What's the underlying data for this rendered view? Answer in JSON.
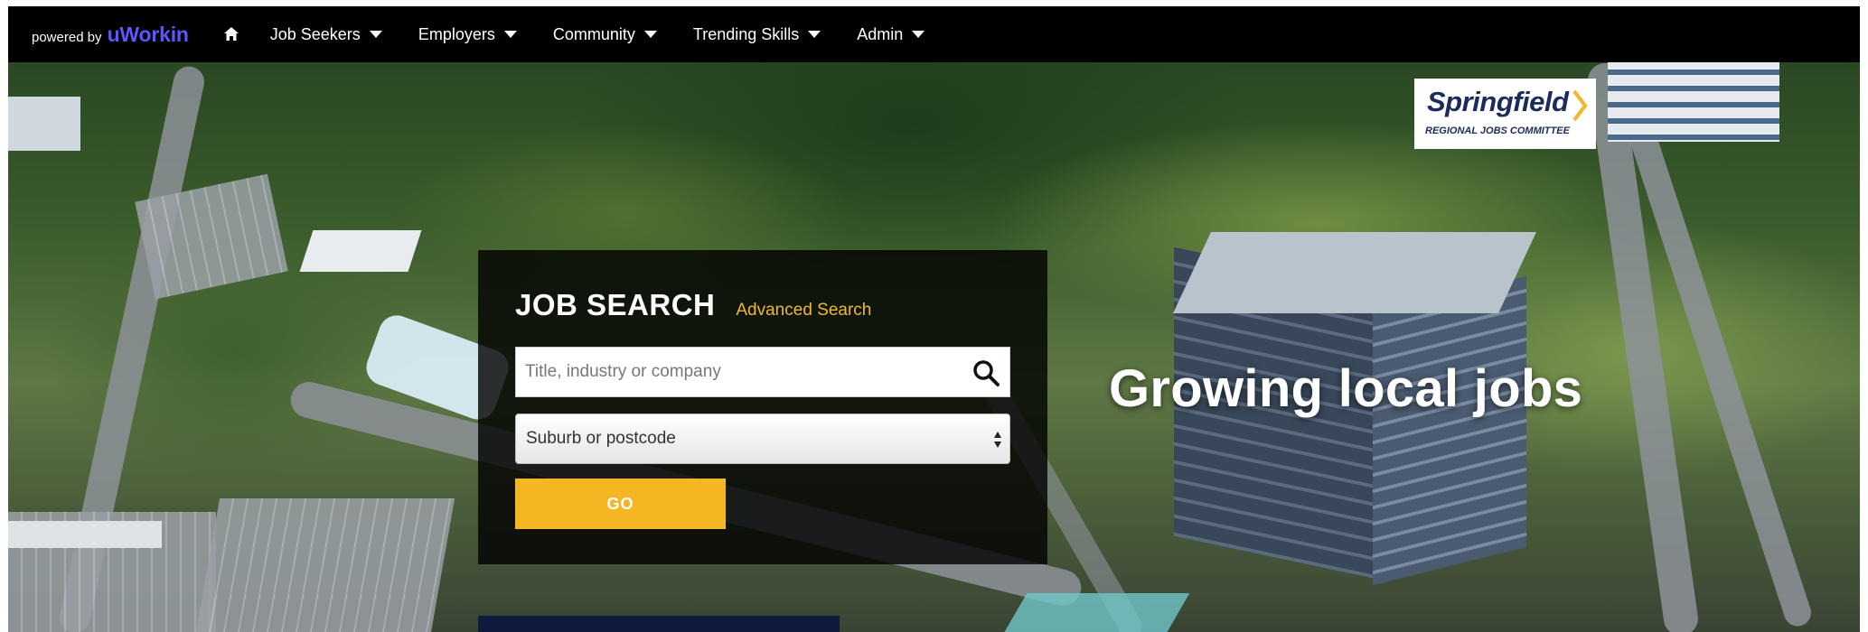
{
  "nav": {
    "powered_by": "powered by",
    "brand": "uWorkin",
    "home_icon": "home-icon",
    "items": [
      {
        "label": "Job Seekers"
      },
      {
        "label": "Employers"
      },
      {
        "label": "Community"
      },
      {
        "label": "Trending Skills"
      },
      {
        "label": "Admin"
      }
    ]
  },
  "partner": {
    "name": "Springfield",
    "subtitle": "REGIONAL JOBS COMMITTEE"
  },
  "search": {
    "title": "JOB SEARCH",
    "advanced_link": "Advanced Search",
    "keyword_placeholder": "Title, industry or company",
    "location_selected": "Suburb or postcode",
    "go_label": "GO"
  },
  "hero": {
    "tagline": "Growing local jobs"
  },
  "colors": {
    "nav_bg": "#000000",
    "brand": "#5b56ff",
    "accent": "#f5b624",
    "link": "#f3b82a",
    "partner_text": "#1b2b5c"
  }
}
